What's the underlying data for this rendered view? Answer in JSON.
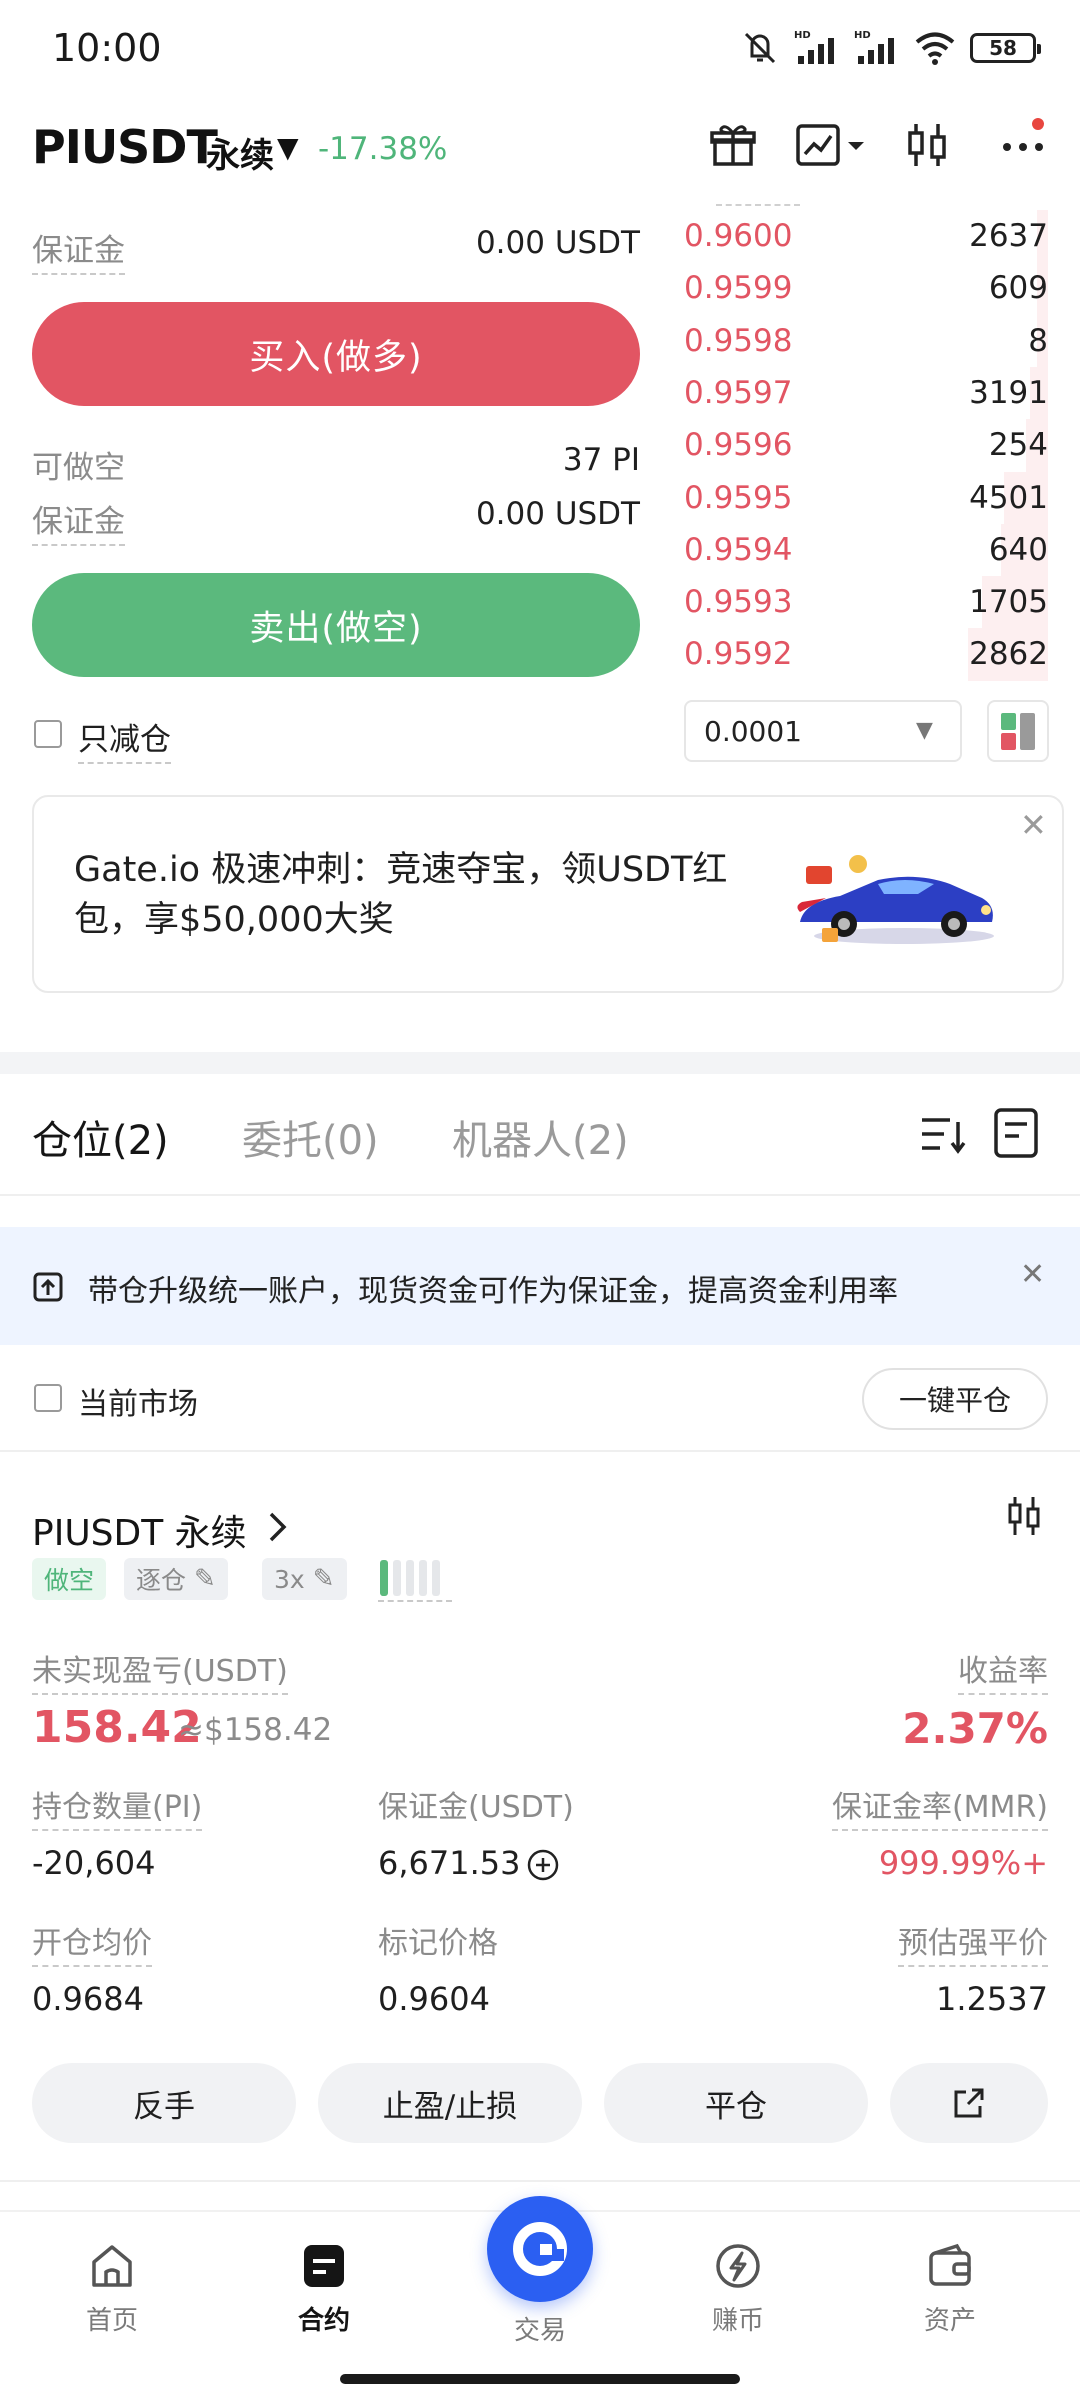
{
  "status_bar": {
    "time": "10:00",
    "battery": "58",
    "hd_label": "HD"
  },
  "header": {
    "pair": "PIUSDT",
    "contract_type": "永续",
    "change": "-17.38%"
  },
  "form": {
    "margin_label": "保证金",
    "margin_value_top": "0.00 USDT",
    "buy_label": "买入(做多)",
    "can_short_label": "可做空",
    "can_short_value": "37 PI",
    "margin_value_bottom": "0.00 USDT",
    "sell_label": "卖出(做空)",
    "reduce_only_label": "只减仓"
  },
  "order_book": {
    "asks": [
      {
        "price": "0.9600",
        "qty": "2637",
        "depth": 0.03
      },
      {
        "price": "0.9599",
        "qty": "609",
        "depth": 0.03
      },
      {
        "price": "0.9598",
        "qty": "8",
        "depth": 0.03
      },
      {
        "price": "0.9597",
        "qty": "3191",
        "depth": 0.05
      },
      {
        "price": "0.9596",
        "qty": "254",
        "depth": 0.06
      },
      {
        "price": "0.9595",
        "qty": "4501",
        "depth": 0.12
      },
      {
        "price": "0.9594",
        "qty": "640",
        "depth": 0.13
      },
      {
        "price": "0.9593",
        "qty": "1705",
        "depth": 0.18
      },
      {
        "price": "0.9592",
        "qty": "2862",
        "depth": 0.22
      }
    ],
    "depth_precision": "0.0001"
  },
  "banner": {
    "text": "Gate.io 极速冲刺：竞速夺宝，领USDT红包，享$50,000大奖"
  },
  "tabs": {
    "positions": "仓位(2)",
    "orders": "委托(0)",
    "bots": "机器人(2)"
  },
  "notice": {
    "text": "带仓升级统一账户，现货资金可作为保证金，提高资金利用率"
  },
  "filter": {
    "current_market_label": "当前市场",
    "close_all_label": "一键平仓"
  },
  "position": {
    "title": "PIUSDT 永续",
    "side_tag": "做空",
    "margin_mode_tag": "逐仓",
    "leverage_tag": "3x",
    "unrealized_pnl_label": "未实现盈亏(USDT)",
    "unrealized_pnl_value": "158.42",
    "unrealized_pnl_approx": "≈$158.42",
    "yield_label": "收益率",
    "yield_value": "2.37%",
    "size_label": "持仓数量(PI)",
    "size_value": "-20,604",
    "margin_label": "保证金(USDT)",
    "margin_value": "6,671.53",
    "mmr_label": "保证金率(MMR)",
    "mmr_value": "999.99%+",
    "entry_label": "开仓均价",
    "entry_value": "0.9684",
    "mark_label": "标记价格",
    "mark_value": "0.9604",
    "liq_label": "预估强平价",
    "liq_value": "1.2537",
    "reverse_label": "反手",
    "tpsl_label": "止盈/止损",
    "close_label": "平仓"
  },
  "nav": {
    "home": "首页",
    "futures": "合约",
    "trade": "交易",
    "earn": "赚币",
    "assets": "资产"
  },
  "colors": {
    "red": "#e25563",
    "green": "#5bb97d",
    "blue": "#2b5ff2"
  }
}
